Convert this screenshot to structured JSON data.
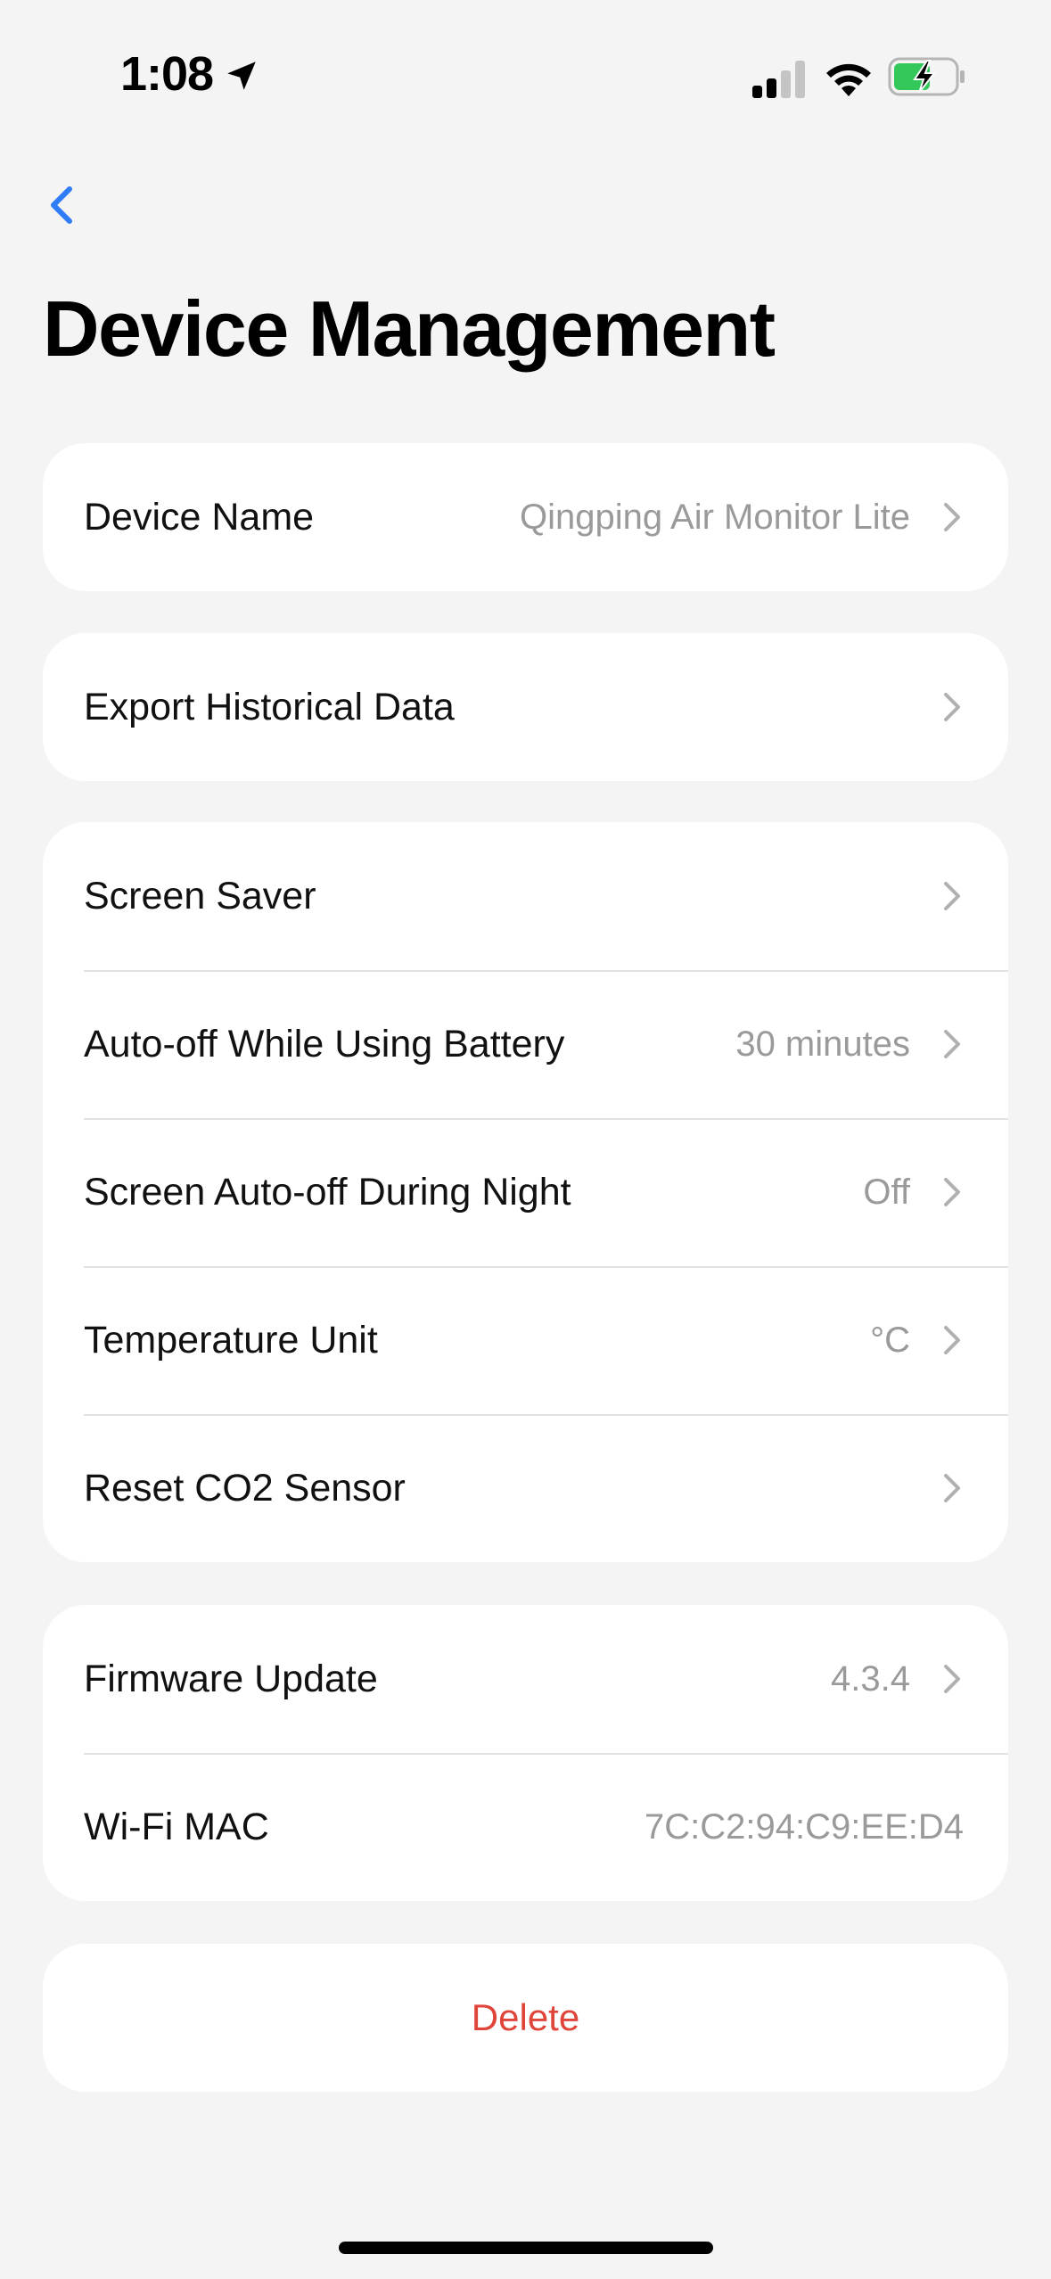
{
  "status_bar": {
    "time": "1:08"
  },
  "page": {
    "title": "Device Management"
  },
  "sections": {
    "device_name": {
      "label": "Device Name",
      "value": "Qingping Air Monitor Lite"
    },
    "export": {
      "label": "Export Historical Data"
    },
    "screen_saver": {
      "label": "Screen Saver"
    },
    "auto_off_battery": {
      "label": "Auto-off While Using Battery",
      "value": "30 minutes"
    },
    "screen_auto_off_night": {
      "label": "Screen Auto-off During Night",
      "value": "Off"
    },
    "temperature_unit": {
      "label": "Temperature Unit",
      "value": "°C"
    },
    "reset_co2": {
      "label": "Reset CO2 Sensor"
    },
    "firmware_update": {
      "label": "Firmware Update",
      "value": "4.3.4"
    },
    "wifi_mac": {
      "label": "Wi-Fi MAC",
      "value": "7C:C2:94:C9:EE:D4"
    },
    "delete": {
      "label": "Delete"
    }
  },
  "colors": {
    "accent": "#2f7cf6",
    "destructive": "#e0453a",
    "secondary_text": "#9a9a9a",
    "background": "#f4f4f4",
    "card": "#ffffff"
  },
  "icons": {
    "back": "chevron-left-icon",
    "row_disclosure": "chevron-right-icon",
    "location": "location-arrow-icon",
    "signal": "cellular-signal-icon",
    "wifi": "wifi-icon",
    "battery": "battery-charging-icon"
  }
}
